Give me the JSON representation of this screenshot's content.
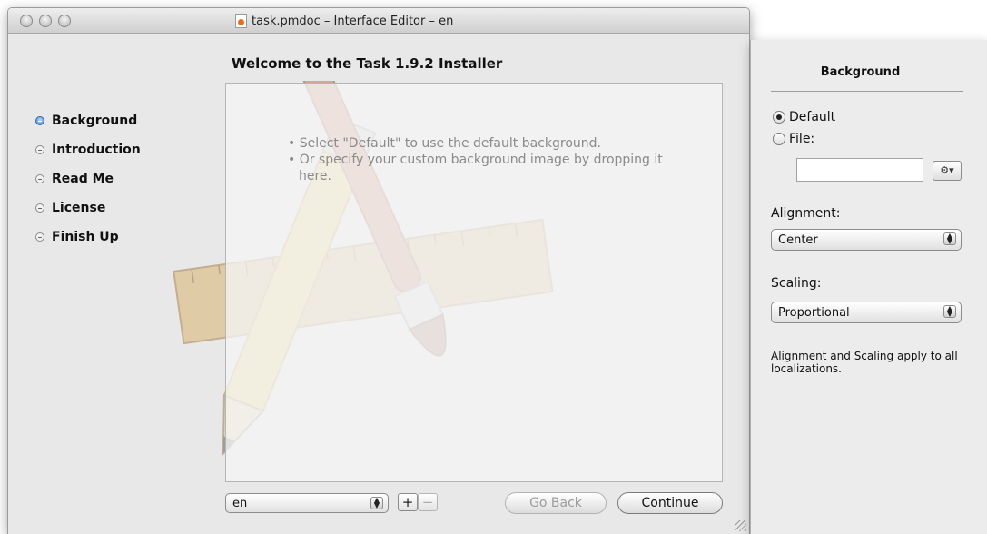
{
  "window": {
    "title": "task.pmdoc – Interface Editor – en",
    "heading": "Welcome to the Task 1.9.2 Installer"
  },
  "steps": [
    {
      "label": "Background",
      "active": true
    },
    {
      "label": "Introduction",
      "active": false
    },
    {
      "label": "Read Me",
      "active": false
    },
    {
      "label": "License",
      "active": false
    },
    {
      "label": "Finish Up",
      "active": false
    }
  ],
  "content": {
    "hints": [
      "Select \"Default\" to use the default background.",
      "Or specify your custom background image by dropping it here."
    ],
    "background_art_icon": "pencil-brush-ruler-icon"
  },
  "bottom_bar": {
    "language_value": "en",
    "add_label": "+",
    "remove_label": "−",
    "back_label": "Go Back",
    "continue_label": "Continue"
  },
  "inspector": {
    "title": "Background",
    "default_label": "Default",
    "file_label": "File:",
    "file_value": "",
    "gear_label": "⚙▾",
    "alignment_label": "Alignment:",
    "alignment_value": "Center",
    "scaling_label": "Scaling:",
    "scaling_value": "Proportional",
    "note": "Alignment and Scaling apply to all localizations."
  },
  "colors": {
    "active_step": "#3f7fd4",
    "window_bg": "#e8e8e8"
  }
}
